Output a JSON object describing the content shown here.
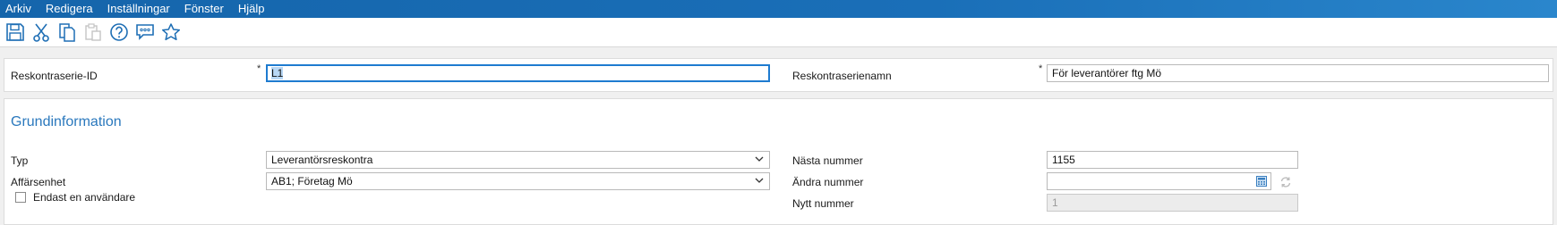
{
  "menu": [
    "Arkiv",
    "Redigera",
    "Inställningar",
    "Fönster",
    "Hjälp"
  ],
  "toolbar": {
    "icons": [
      "save-icon",
      "cut-icon",
      "copy-icon",
      "paste-icon",
      "help-icon",
      "comment-icon",
      "favorite-star-icon"
    ]
  },
  "header": {
    "id_label": "Reskontraserie-ID",
    "id_value": "L1",
    "name_label": "Reskontraserienamn",
    "name_value": "För leverantörer ftg Mö",
    "required_mark": "*"
  },
  "section": {
    "title": "Grundinformation",
    "typ_label": "Typ",
    "typ_value": "Leverantörsreskontra",
    "affarsenhet_label": "Affärsenhet",
    "affarsenhet_value": "AB1; Företag Mö",
    "endast_label": "Endast en användare",
    "endast_checked": false,
    "nasta_label": "Nästa nummer",
    "nasta_value": "1155",
    "andra_label": "Ändra nummer",
    "andra_value": "",
    "nytt_label": "Nytt nummer",
    "nytt_value": "1"
  },
  "colors": {
    "menubar": "#1565ab",
    "accent": "#2a78bd",
    "focus_border": "#1e7bd0"
  }
}
